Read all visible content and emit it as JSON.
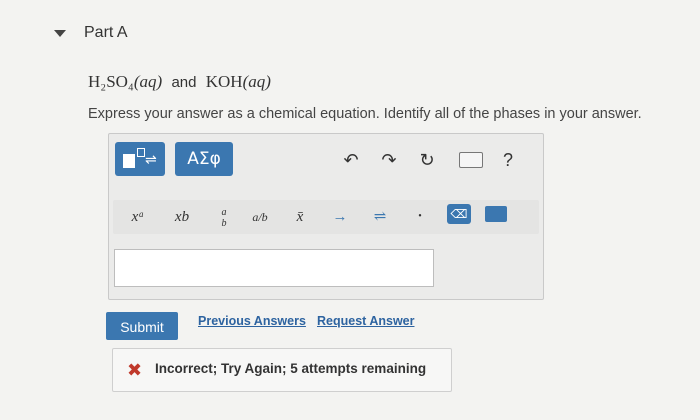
{
  "part": {
    "title": "Part A"
  },
  "question": {
    "reactant1_formula": "H₂SO₄",
    "reactant1_phase": "(aq)",
    "connector": "and",
    "reactant2_formula": "KOH",
    "reactant2_phase": "(aq)"
  },
  "instruction": "Express your answer as a chemical equation. Identify all of the phases in your answer.",
  "toolbar": {
    "symbols_label": "ΑΣφ",
    "undo_glyph": "↶",
    "redo_glyph": "↷",
    "reset_glyph": "↻",
    "help_label": "?",
    "superscript_label": "xᵃ",
    "subscript_label": "xb",
    "fraction_top": "a",
    "fraction_bottom": "b",
    "fraction2_label": "a/b",
    "overline_label": "x̄",
    "arrow_label": "→",
    "equilibrium_label": "⇌",
    "dot_label": "•",
    "delete_label": "⌫"
  },
  "answer_input": {
    "value": ""
  },
  "actions": {
    "submit_label": "Submit",
    "previous_answers_label": "Previous Answers",
    "request_answer_label": "Request Answer"
  },
  "feedback": {
    "icon": "x-icon",
    "text": "Incorrect; Try Again; 5 attempts remaining"
  },
  "colors": {
    "accent": "#3b77b0",
    "link": "#2d63a0",
    "error": "#c0392b"
  }
}
